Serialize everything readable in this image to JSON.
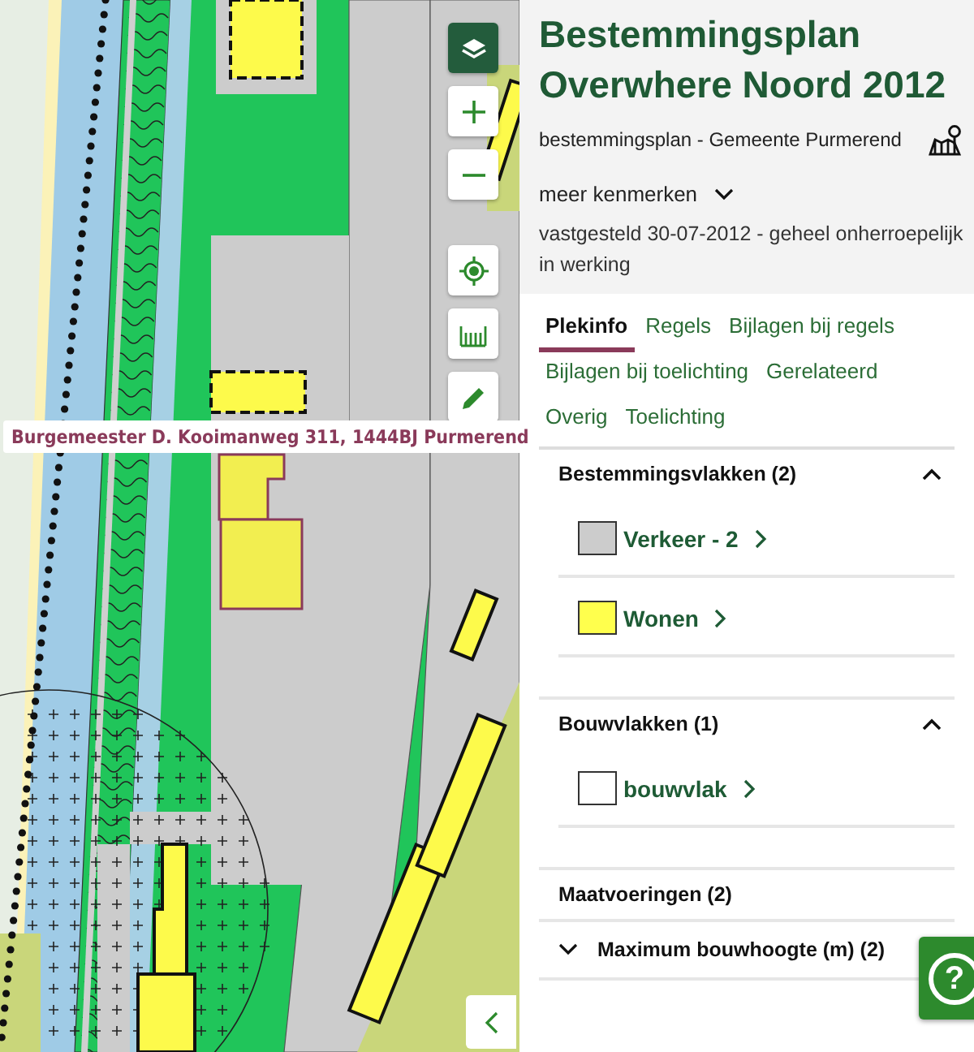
{
  "map": {
    "address_label": "Burgemeester D. Kooimanweg 311, 1444BJ Purmerend"
  },
  "plan": {
    "title": "Bestemmingsplan Overwhere Noord 2012",
    "subtitle": "bestemmingsplan - Gemeente Purmerend",
    "more_toggle": {
      "label": "meer kenmerken",
      "expanded": false
    },
    "status": "vastgesteld 30-07-2012 - geheel onherroepelijk in werking"
  },
  "tabs": [
    {
      "label": "Plekinfo",
      "selected": true
    },
    {
      "label": "Regels",
      "selected": false
    },
    {
      "label": "Bijlagen bij regels",
      "selected": false
    },
    {
      "label": "Bijlagen bij toelichting",
      "selected": false
    },
    {
      "label": "Gerelateerd",
      "selected": false
    },
    {
      "label": "Overig",
      "selected": false
    },
    {
      "label": "Toelichting",
      "selected": false
    }
  ],
  "sections": [
    {
      "title": "Bestemmingsvlakken (2)",
      "expanded": true,
      "items": [
        {
          "label": "Verkeer - 2",
          "color": "#cccccc"
        },
        {
          "label": "Wonen",
          "color": "#ffff4d"
        }
      ]
    },
    {
      "title": "Bouwvlakken (1)",
      "expanded": true,
      "items": [
        {
          "label": "bouwvlak",
          "color": "#ffffff"
        }
      ]
    },
    {
      "title": "Maatvoeringen (2)",
      "subitems": [
        {
          "label": "Maximum bouwhoogte (m) (2)",
          "expanded": false
        }
      ]
    }
  ],
  "help_button": {
    "label": "?"
  }
}
